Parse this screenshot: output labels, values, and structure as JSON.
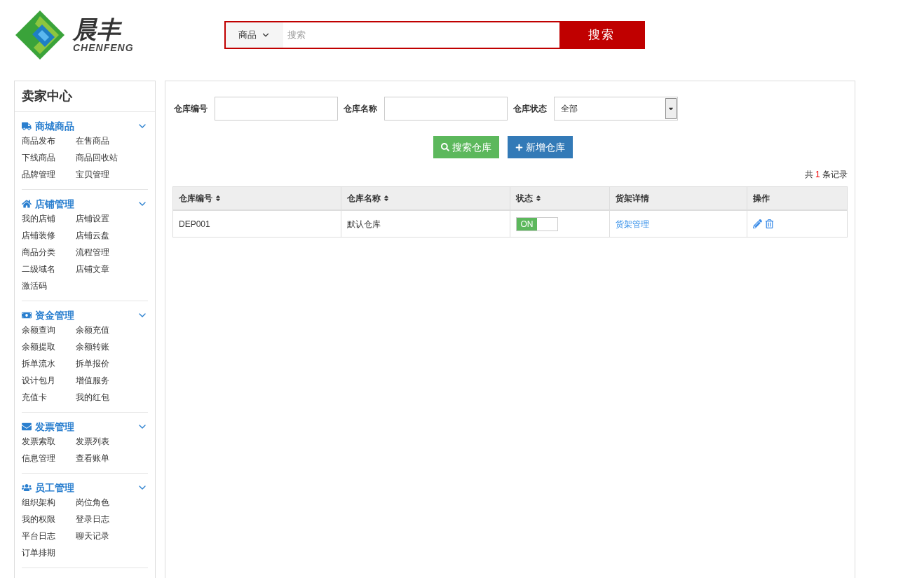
{
  "logo": {
    "name": "晨丰",
    "latin": "CHENFENG"
  },
  "search": {
    "category": "商品",
    "placeholder": "搜索",
    "button": "搜索"
  },
  "sidebar": {
    "title": "卖家中心",
    "sections": [
      {
        "title": "商城商品",
        "expanded": true,
        "items": [
          "商品发布",
          "在售商品",
          "下线商品",
          "商品回收站",
          "品牌管理",
          "宝贝管理"
        ]
      },
      {
        "title": "店铺管理",
        "expanded": true,
        "items": [
          "我的店铺",
          "店铺设置",
          "店铺装修",
          "店铺云盘",
          "商品分类",
          "流程管理",
          "二级域名",
          "店铺文章",
          "激活码"
        ]
      },
      {
        "title": "资金管理",
        "expanded": true,
        "items": [
          "余额查询",
          "余额充值",
          "余额提取",
          "余额转账",
          "拆单流水",
          "拆单报价",
          "设计包月",
          "增值服务",
          "充值卡",
          "我的红包"
        ]
      },
      {
        "title": "发票管理",
        "expanded": true,
        "items": [
          "发票索取",
          "发票列表",
          "信息管理",
          "查看账单"
        ]
      },
      {
        "title": "员工管理",
        "expanded": true,
        "items": [
          "组织架构",
          "岗位角色",
          "我的权限",
          "登录日志",
          "平台日志",
          "聊天记录",
          "订单排期"
        ]
      }
    ]
  },
  "filters": [
    {
      "kind": "input",
      "label": "仓库编号"
    },
    {
      "kind": "input",
      "label": "仓库名称"
    },
    {
      "kind": "select",
      "label": "仓库状态",
      "value": "全部"
    }
  ],
  "actions": [
    {
      "kind": "search",
      "label": "搜索仓库"
    },
    {
      "kind": "add",
      "label": "新增仓库"
    }
  ],
  "record_count": {
    "prefix": "共",
    "count": "1",
    "suffix": "条记录"
  },
  "table": {
    "columns": [
      {
        "label": "仓库编号",
        "sortable": true
      },
      {
        "label": "仓库名称",
        "sortable": true
      },
      {
        "label": "状态",
        "sortable": true
      },
      {
        "label": "货架详情",
        "sortable": false
      },
      {
        "label": "操作",
        "sortable": false
      }
    ],
    "rows": [
      {
        "code": "DEP001",
        "name": "默认仓库",
        "status": {
          "label": "ON",
          "on": true
        },
        "shelf_link": "货架管理"
      }
    ]
  }
}
